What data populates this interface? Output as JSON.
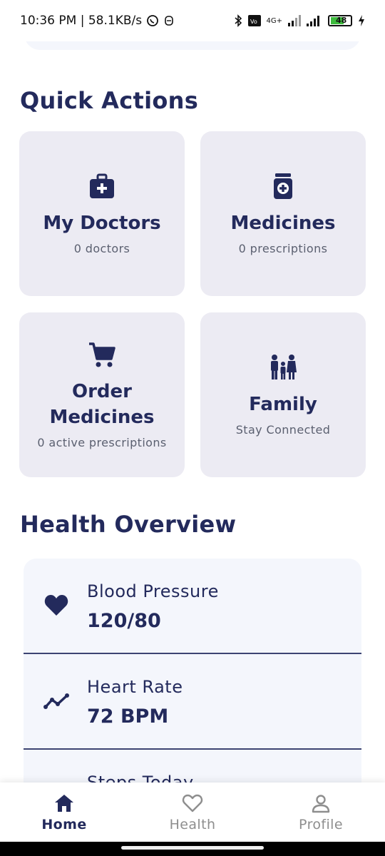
{
  "status_bar": {
    "time_speed": "10:36 PM | 58.1KB/s",
    "network": "4G+",
    "battery": "48"
  },
  "quick_actions": {
    "title": "Quick Actions",
    "tiles": [
      {
        "title": "My Doctors",
        "subtitle": "0 doctors",
        "icon": "medical-bag-icon"
      },
      {
        "title": "Medicines",
        "subtitle": "0 prescriptions",
        "icon": "medicine-bottle-icon"
      },
      {
        "title": "Order Medicines",
        "subtitle": "0 active prescriptions",
        "icon": "cart-icon"
      },
      {
        "title": "Family",
        "subtitle": "Stay Connected",
        "icon": "family-icon"
      }
    ]
  },
  "health_overview": {
    "title": "Health Overview",
    "rows": [
      {
        "label": "Blood Pressure",
        "value": "120/80",
        "icon": "heart-icon"
      },
      {
        "label": "Heart Rate",
        "value": "72 BPM",
        "icon": "trend-line-icon"
      },
      {
        "label": "Steps Today",
        "value": "",
        "icon": "steps-icon"
      }
    ]
  },
  "bottom_nav": {
    "items": [
      {
        "label": "Home",
        "icon": "home-icon",
        "active": true
      },
      {
        "label": "Health",
        "icon": "heart-outline-icon",
        "active": false
      },
      {
        "label": "Profile",
        "icon": "person-icon",
        "active": false
      }
    ],
    "active_color": "#232a5c",
    "inactive_color": "#8e8e8e"
  },
  "colors": {
    "primary": "#232a5c",
    "tile_bg": "#ecebf3",
    "card_bg": "#f4f6fc"
  }
}
